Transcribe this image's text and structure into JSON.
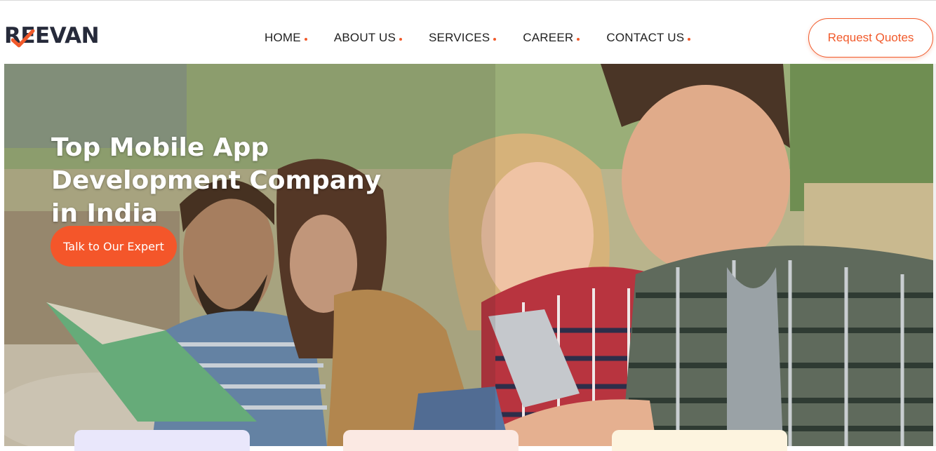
{
  "brand": {
    "logo_text": "REEVAN",
    "accent": "#f15a2b",
    "dark": "#262a3a"
  },
  "nav": {
    "items": [
      {
        "label": "HOME"
      },
      {
        "label": "ABOUT US"
      },
      {
        "label": "SERVICES"
      },
      {
        "label": "CAREER"
      },
      {
        "label": "CONTACT US"
      }
    ]
  },
  "header": {
    "cta_label": "Request Quotes"
  },
  "hero": {
    "title": "Top Mobile App Development Company in India",
    "button_label": "Talk to Our Expert",
    "image": "group-of-students-reading-books-outdoors"
  },
  "cards": [
    {
      "color": "#e9e7fb"
    },
    {
      "color": "#fbe9e3"
    },
    {
      "color": "#fdf4df"
    }
  ]
}
